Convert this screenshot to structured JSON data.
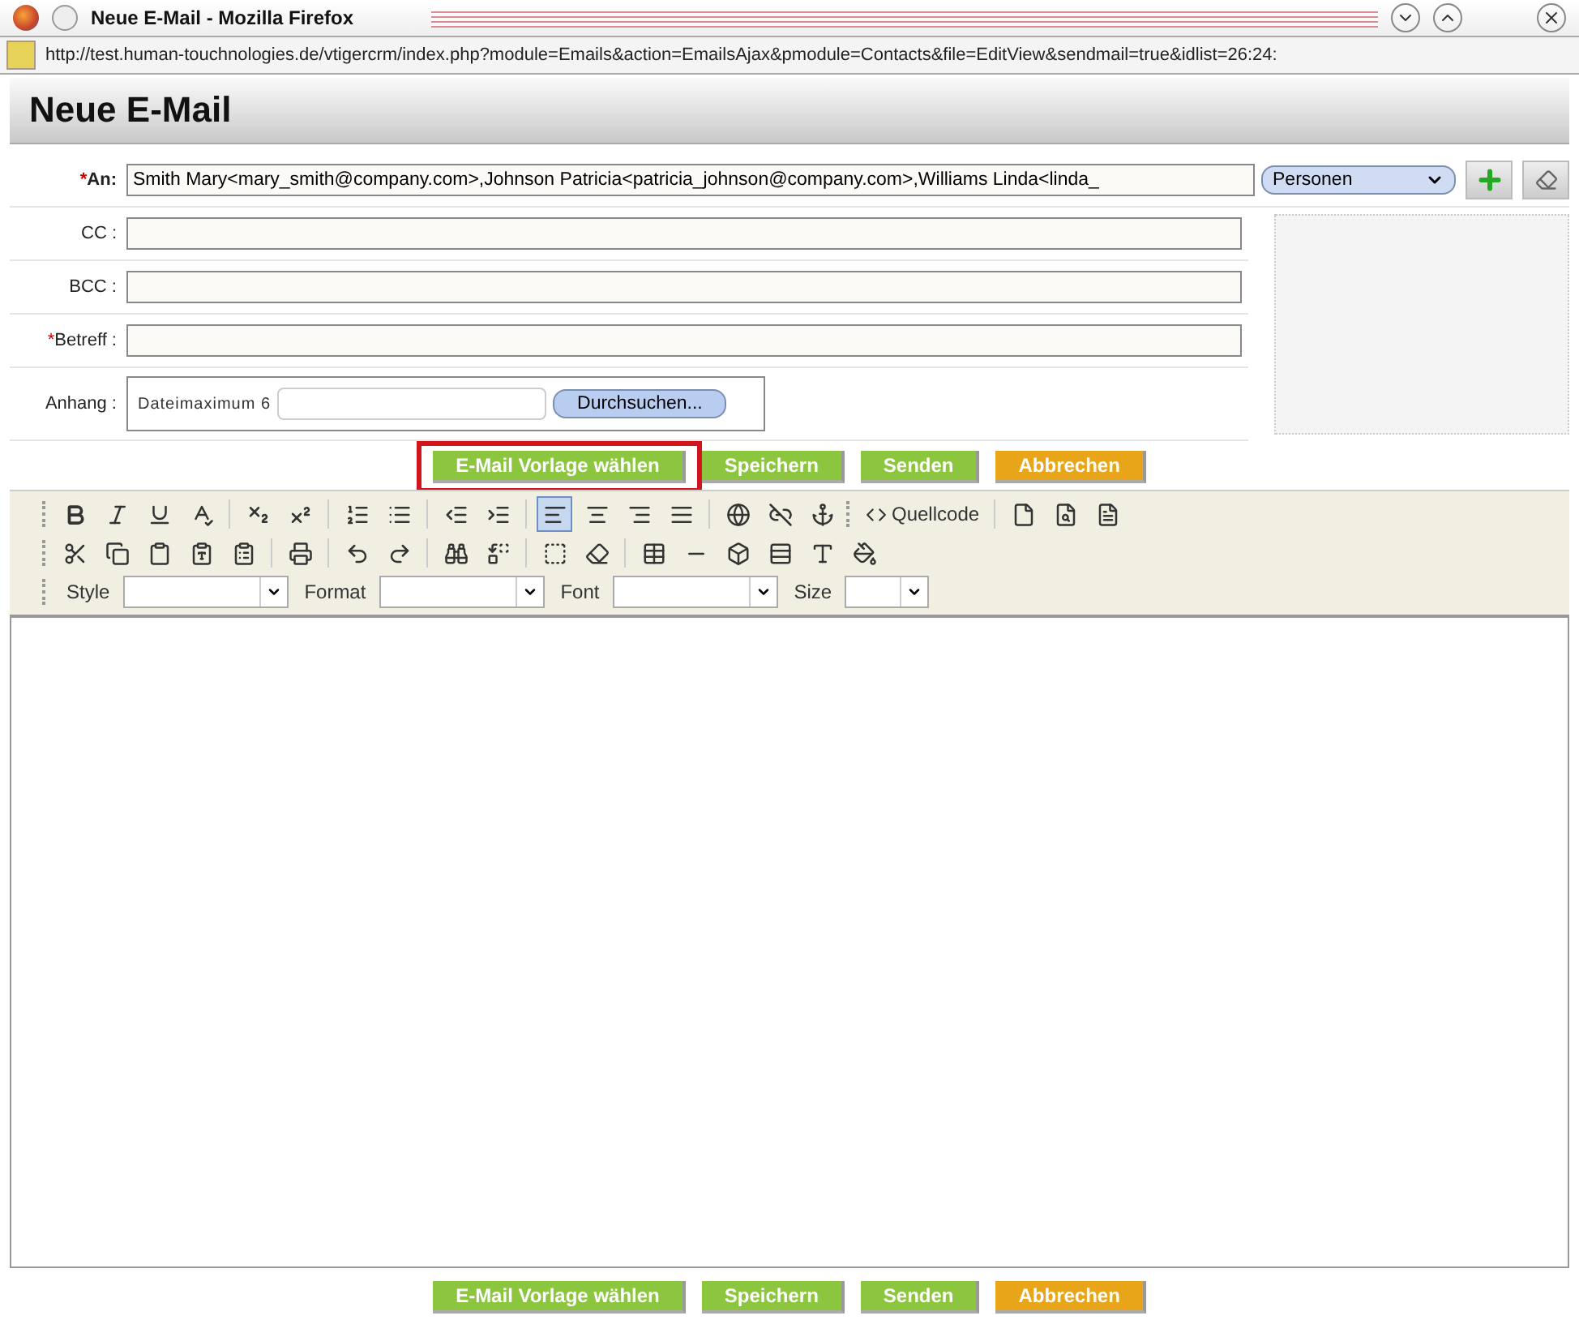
{
  "window": {
    "title": "Neue E-Mail - Mozilla Firefox"
  },
  "address_bar": {
    "url": "http://test.human-touchnologies.de/vtigercrm/index.php?module=Emails&action=EmailsAjax&pmodule=Contacts&file=EditView&sendmail=true&idlist=26:24:"
  },
  "page_title": "Neue E-Mail",
  "fields": [
    {
      "label": "An:",
      "required_mark": "*",
      "bold": true,
      "value": "Smith Mary<mary_smith@company.com>,Johnson Patricia<patricia_johnson@company.com>,Williams Linda<linda_"
    },
    {
      "label": "CC :",
      "bold": false
    },
    {
      "label": "BCC :",
      "bold": false
    },
    {
      "label": "Betreff :",
      "required_mark": "*",
      "bold": false
    }
  ],
  "recipient_type": "Personen",
  "attachment": {
    "label": "Anhang :",
    "hint": "Dateimaximum 6",
    "browse": "Durchsuchen..."
  },
  "top_actions": [
    {
      "label": "E-Mail Vorlage wählen",
      "kind": "primary",
      "highlighted": true
    },
    {
      "label": "Speichern",
      "kind": "primary",
      "highlighted": false
    },
    {
      "label": "Senden",
      "kind": "primary",
      "highlighted": false
    },
    {
      "label": "Abbrechen",
      "kind": "cancel",
      "highlighted": false
    }
  ],
  "editor": {
    "source_button": "Quellcode",
    "dropdowns": [
      "Style",
      "Format",
      "Font",
      "Size"
    ]
  },
  "bottom_actions": [
    {
      "label": "E-Mail Vorlage wählen",
      "kind": "primary",
      "highlighted": false
    },
    {
      "label": "Speichern",
      "kind": "primary",
      "highlighted": false
    },
    {
      "label": "Senden",
      "kind": "primary",
      "highlighted": false
    },
    {
      "label": "Abbrechen",
      "kind": "cancel",
      "highlighted": false
    }
  ]
}
